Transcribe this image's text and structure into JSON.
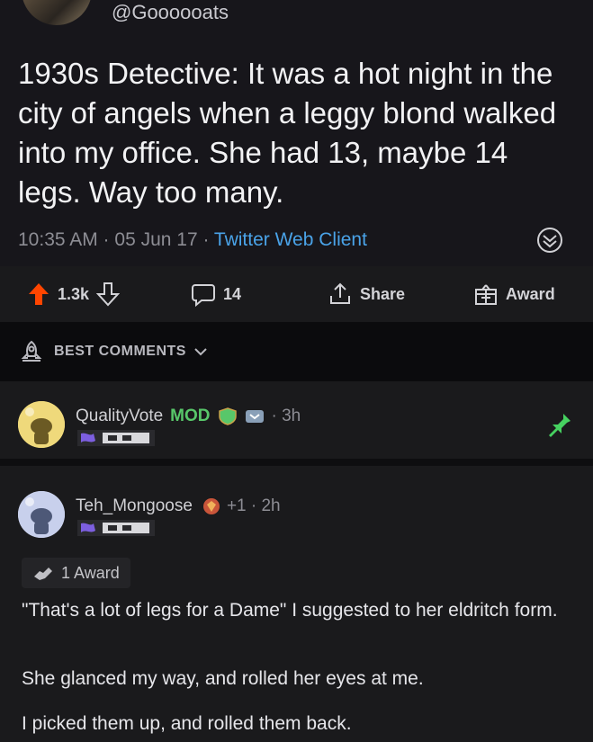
{
  "tweet": {
    "handle": "@Goooooats",
    "text": "1930s Detective: It was a hot night in the city of angels when a leggy blond walked into my office. She had 13, maybe 14 legs. Way too many.",
    "time_date": "10:35 AM · 05 Jun 17 · ",
    "client": "Twitter Web Client"
  },
  "actions": {
    "score": "1.3k",
    "comments": "14",
    "share": "Share",
    "award": "Award"
  },
  "sort": {
    "label": "BEST COMMENTS"
  },
  "comments": [
    {
      "user": "QualityVote",
      "mod_badge": "MOD",
      "age": "· 3h"
    },
    {
      "user": "Teh_Mongoose",
      "karma_tag": "+1 · 2h",
      "award_label": "1 Award",
      "paragraphs": [
        "\"That's a lot of legs for a Dame\" I suggested to her eldritch form.",
        "She glanced my way, and rolled her eyes at me.",
        "I picked them up, and rolled them back."
      ]
    }
  ],
  "colors": {
    "upvote": "#ff4500",
    "mod_green": "#58c76a",
    "link_blue": "#4aa3e8",
    "pin_green": "#46d160"
  }
}
